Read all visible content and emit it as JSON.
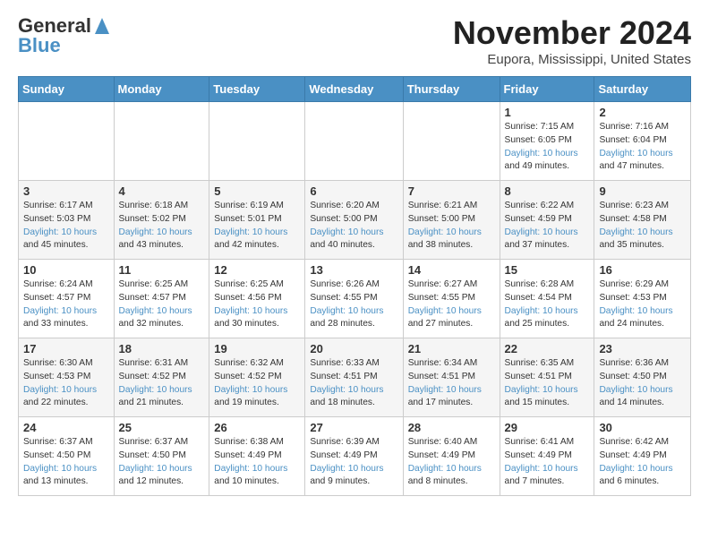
{
  "header": {
    "logo_line1": "General",
    "logo_line2": "Blue",
    "month": "November 2024",
    "location": "Eupora, Mississippi, United States"
  },
  "days_of_week": [
    "Sunday",
    "Monday",
    "Tuesday",
    "Wednesday",
    "Thursday",
    "Friday",
    "Saturday"
  ],
  "weeks": [
    [
      {
        "day": "",
        "content": ""
      },
      {
        "day": "",
        "content": ""
      },
      {
        "day": "",
        "content": ""
      },
      {
        "day": "",
        "content": ""
      },
      {
        "day": "",
        "content": ""
      },
      {
        "day": "1",
        "content": "Sunrise: 7:15 AM\nSunset: 6:05 PM\nDaylight: 10 hours\nand 49 minutes."
      },
      {
        "day": "2",
        "content": "Sunrise: 7:16 AM\nSunset: 6:04 PM\nDaylight: 10 hours\nand 47 minutes."
      }
    ],
    [
      {
        "day": "3",
        "content": "Sunrise: 6:17 AM\nSunset: 5:03 PM\nDaylight: 10 hours\nand 45 minutes."
      },
      {
        "day": "4",
        "content": "Sunrise: 6:18 AM\nSunset: 5:02 PM\nDaylight: 10 hours\nand 43 minutes."
      },
      {
        "day": "5",
        "content": "Sunrise: 6:19 AM\nSunset: 5:01 PM\nDaylight: 10 hours\nand 42 minutes."
      },
      {
        "day": "6",
        "content": "Sunrise: 6:20 AM\nSunset: 5:00 PM\nDaylight: 10 hours\nand 40 minutes."
      },
      {
        "day": "7",
        "content": "Sunrise: 6:21 AM\nSunset: 5:00 PM\nDaylight: 10 hours\nand 38 minutes."
      },
      {
        "day": "8",
        "content": "Sunrise: 6:22 AM\nSunset: 4:59 PM\nDaylight: 10 hours\nand 37 minutes."
      },
      {
        "day": "9",
        "content": "Sunrise: 6:23 AM\nSunset: 4:58 PM\nDaylight: 10 hours\nand 35 minutes."
      }
    ],
    [
      {
        "day": "10",
        "content": "Sunrise: 6:24 AM\nSunset: 4:57 PM\nDaylight: 10 hours\nand 33 minutes."
      },
      {
        "day": "11",
        "content": "Sunrise: 6:25 AM\nSunset: 4:57 PM\nDaylight: 10 hours\nand 32 minutes."
      },
      {
        "day": "12",
        "content": "Sunrise: 6:25 AM\nSunset: 4:56 PM\nDaylight: 10 hours\nand 30 minutes."
      },
      {
        "day": "13",
        "content": "Sunrise: 6:26 AM\nSunset: 4:55 PM\nDaylight: 10 hours\nand 28 minutes."
      },
      {
        "day": "14",
        "content": "Sunrise: 6:27 AM\nSunset: 4:55 PM\nDaylight: 10 hours\nand 27 minutes."
      },
      {
        "day": "15",
        "content": "Sunrise: 6:28 AM\nSunset: 4:54 PM\nDaylight: 10 hours\nand 25 minutes."
      },
      {
        "day": "16",
        "content": "Sunrise: 6:29 AM\nSunset: 4:53 PM\nDaylight: 10 hours\nand 24 minutes."
      }
    ],
    [
      {
        "day": "17",
        "content": "Sunrise: 6:30 AM\nSunset: 4:53 PM\nDaylight: 10 hours\nand 22 minutes."
      },
      {
        "day": "18",
        "content": "Sunrise: 6:31 AM\nSunset: 4:52 PM\nDaylight: 10 hours\nand 21 minutes."
      },
      {
        "day": "19",
        "content": "Sunrise: 6:32 AM\nSunset: 4:52 PM\nDaylight: 10 hours\nand 19 minutes."
      },
      {
        "day": "20",
        "content": "Sunrise: 6:33 AM\nSunset: 4:51 PM\nDaylight: 10 hours\nand 18 minutes."
      },
      {
        "day": "21",
        "content": "Sunrise: 6:34 AM\nSunset: 4:51 PM\nDaylight: 10 hours\nand 17 minutes."
      },
      {
        "day": "22",
        "content": "Sunrise: 6:35 AM\nSunset: 4:51 PM\nDaylight: 10 hours\nand 15 minutes."
      },
      {
        "day": "23",
        "content": "Sunrise: 6:36 AM\nSunset: 4:50 PM\nDaylight: 10 hours\nand 14 minutes."
      }
    ],
    [
      {
        "day": "24",
        "content": "Sunrise: 6:37 AM\nSunset: 4:50 PM\nDaylight: 10 hours\nand 13 minutes."
      },
      {
        "day": "25",
        "content": "Sunrise: 6:37 AM\nSunset: 4:50 PM\nDaylight: 10 hours\nand 12 minutes."
      },
      {
        "day": "26",
        "content": "Sunrise: 6:38 AM\nSunset: 4:49 PM\nDaylight: 10 hours\nand 10 minutes."
      },
      {
        "day": "27",
        "content": "Sunrise: 6:39 AM\nSunset: 4:49 PM\nDaylight: 10 hours\nand 9 minutes."
      },
      {
        "day": "28",
        "content": "Sunrise: 6:40 AM\nSunset: 4:49 PM\nDaylight: 10 hours\nand 8 minutes."
      },
      {
        "day": "29",
        "content": "Sunrise: 6:41 AM\nSunset: 4:49 PM\nDaylight: 10 hours\nand 7 minutes."
      },
      {
        "day": "30",
        "content": "Sunrise: 6:42 AM\nSunset: 4:49 PM\nDaylight: 10 hours\nand 6 minutes."
      }
    ]
  ]
}
